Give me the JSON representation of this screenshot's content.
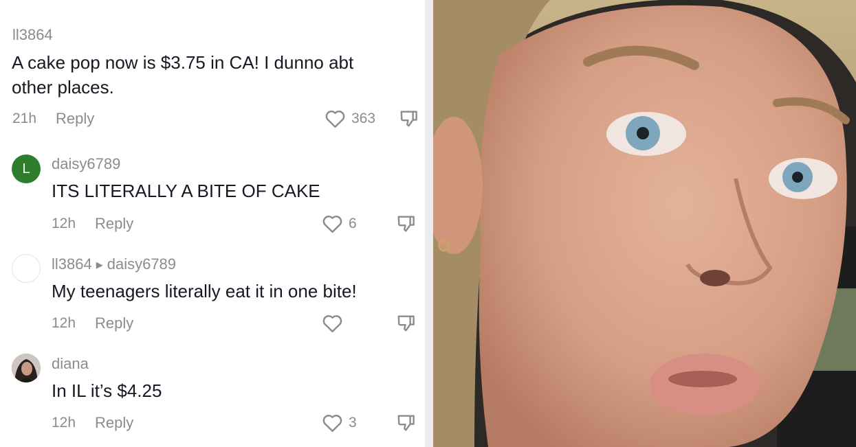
{
  "comments": [
    {
      "username": "ll3864",
      "text_lines": [
        "A cake pop now is $3.75 in CA! I dunno abt",
        "other places."
      ],
      "time": "21h",
      "reply_label": "Reply",
      "likes": "363"
    },
    {
      "username": "daisy6789",
      "avatar_letter": "L",
      "text": "ITS LITERALLY A BITE OF CAKE",
      "time": "12h",
      "reply_label": "Reply",
      "likes": "6"
    },
    {
      "username": "ll3864",
      "reply_to": "daisy6789",
      "text": "My teenagers literally eat it in one bite!",
      "time": "12h",
      "reply_label": "Reply",
      "likes": ""
    },
    {
      "username": "diana",
      "text": "In IL it’s $4.25",
      "time": "12h",
      "reply_label": "Reply",
      "likes": "3"
    }
  ],
  "icons": {
    "like": "heart-outline-icon",
    "dislike": "thumbs-down-outline-icon",
    "reply_indicator": "triangle-right-icon"
  },
  "colors": {
    "text": "#161823",
    "secondary_text": "#8a8b91",
    "avatar_green": "#2e7d2b"
  }
}
